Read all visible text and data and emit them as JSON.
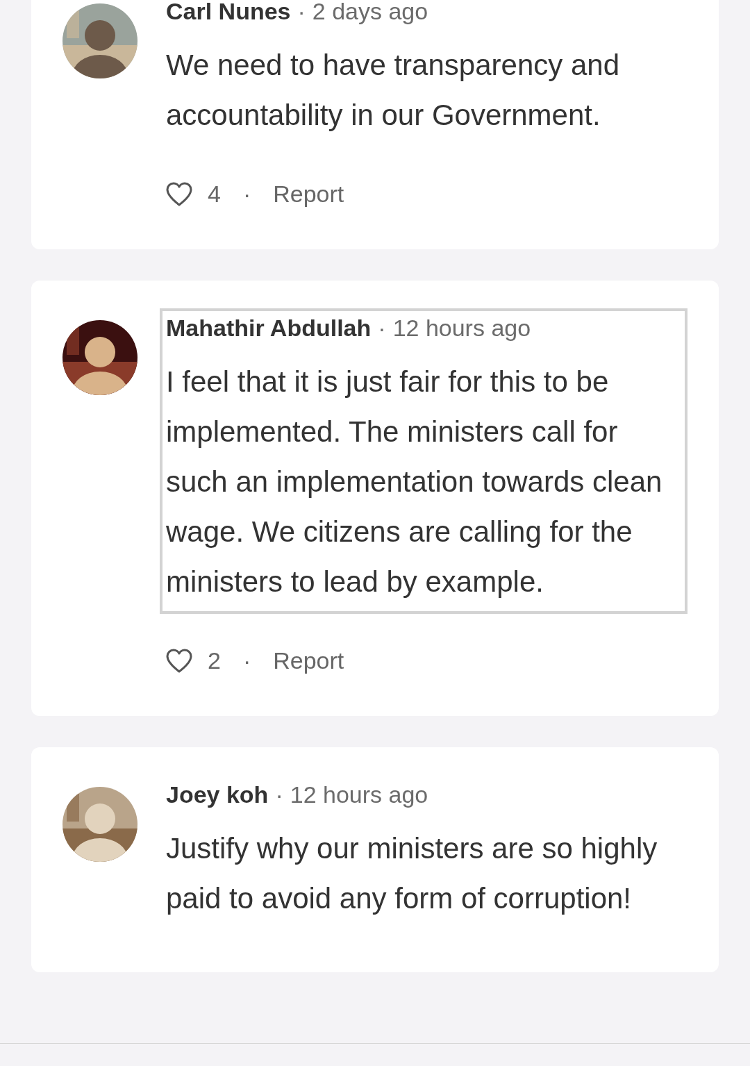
{
  "comments": [
    {
      "author": "Carl Nunes",
      "meta_separator": "·",
      "time": "2 days ago",
      "highlighted": false,
      "body": "We need to have transparency and accountability in our Government.",
      "likes": "4",
      "action_separator": "·",
      "report": "Report"
    },
    {
      "author": "Mahathir Abdullah",
      "meta_separator": "·",
      "time": "12 hours ago",
      "highlighted": true,
      "body": "I feel that it is just fair for this to be implemented. The ministers call for such an implementation towards clean wage. We citizens are calling for the ministers to lead by example.",
      "likes": "2",
      "action_separator": "·",
      "report": "Report"
    },
    {
      "author": "Joey koh",
      "meta_separator": "·",
      "time": "12 hours ago",
      "highlighted": false,
      "body": "Justify why our ministers are so highly paid to avoid any form of corruption!"
    }
  ]
}
